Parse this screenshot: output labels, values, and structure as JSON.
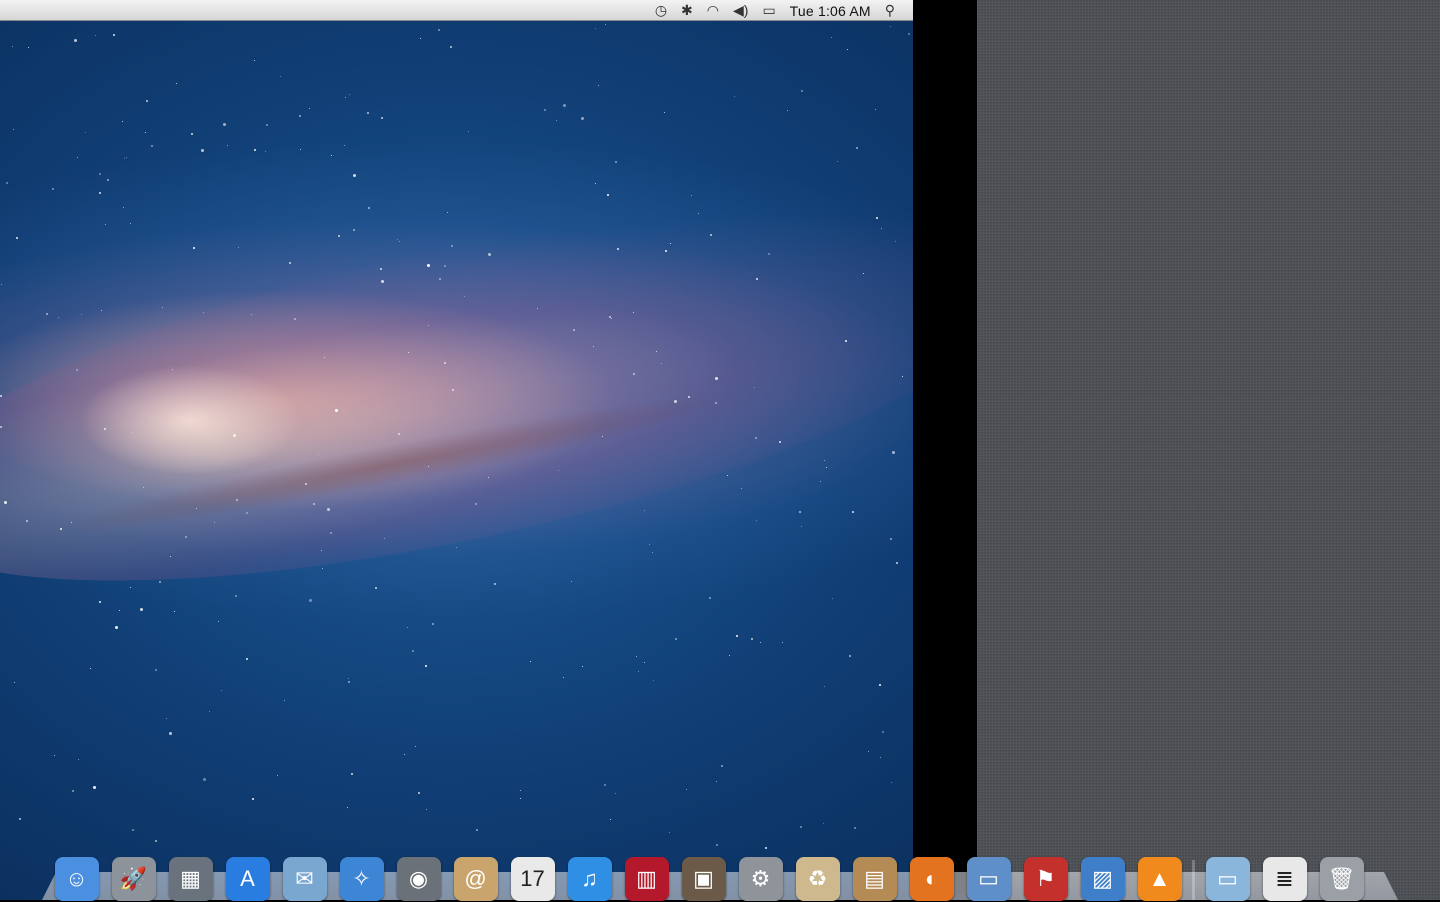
{
  "menubar": {
    "extras": [
      {
        "name": "time-machine-icon",
        "glyph": "◷"
      },
      {
        "name": "bluetooth-icon",
        "glyph": "✱"
      },
      {
        "name": "wifi-icon",
        "glyph": "◠"
      },
      {
        "name": "volume-icon",
        "glyph": "◀)"
      },
      {
        "name": "battery-icon",
        "glyph": "▭"
      }
    ],
    "clock": "Tue 1:06 AM",
    "spotlight_icon": "⚲"
  },
  "dock": {
    "apps": [
      {
        "name": "finder",
        "glyph": "☺",
        "bg": "#4a8fe0"
      },
      {
        "name": "launchpad",
        "glyph": "🚀",
        "bg": "#8d939b"
      },
      {
        "name": "mission-control",
        "glyph": "▦",
        "bg": "#6a737d"
      },
      {
        "name": "app-store",
        "glyph": "A",
        "bg": "#2a7de0"
      },
      {
        "name": "mail",
        "glyph": "✉",
        "bg": "#7aa7cf"
      },
      {
        "name": "safari",
        "glyph": "✧",
        "bg": "#3d86d6"
      },
      {
        "name": "facetime",
        "glyph": "◉",
        "bg": "#6b7179"
      },
      {
        "name": "address-book",
        "glyph": "@",
        "bg": "#c9a46d"
      },
      {
        "name": "ical",
        "glyph": "17",
        "bg": "#e9e9e9"
      },
      {
        "name": "itunes",
        "glyph": "♫",
        "bg": "#2e8fe5"
      },
      {
        "name": "photo-booth",
        "glyph": "▥",
        "bg": "#b3192b"
      },
      {
        "name": "iphoto",
        "glyph": "▣",
        "bg": "#6b5a48"
      },
      {
        "name": "system-preferences",
        "glyph": "⚙",
        "bg": "#8f949b"
      },
      {
        "name": "recycle-archive",
        "glyph": "♻",
        "bg": "#cdb98d"
      },
      {
        "name": "archive-utility",
        "glyph": "▤",
        "bg": "#b58b55"
      },
      {
        "name": "firefox",
        "glyph": "◐",
        "bg": "#e3731f"
      },
      {
        "name": "screen-sharing",
        "glyph": "▭",
        "bg": "#5f8fc8"
      },
      {
        "name": "helper-app",
        "glyph": "⚑",
        "bg": "#c4302b"
      },
      {
        "name": "preview",
        "glyph": "▨",
        "bg": "#3f7fc9"
      },
      {
        "name": "vlc",
        "glyph": "▲",
        "bg": "#f08a1c"
      }
    ],
    "stacks": [
      {
        "name": "applications-folder",
        "glyph": "▭",
        "bg": "#8ab6dc"
      },
      {
        "name": "documents-stack",
        "glyph": "≣",
        "bg": "#e8e8e8"
      },
      {
        "name": "trash",
        "glyph": "🗑",
        "bg": "#9aa0a6"
      }
    ]
  }
}
